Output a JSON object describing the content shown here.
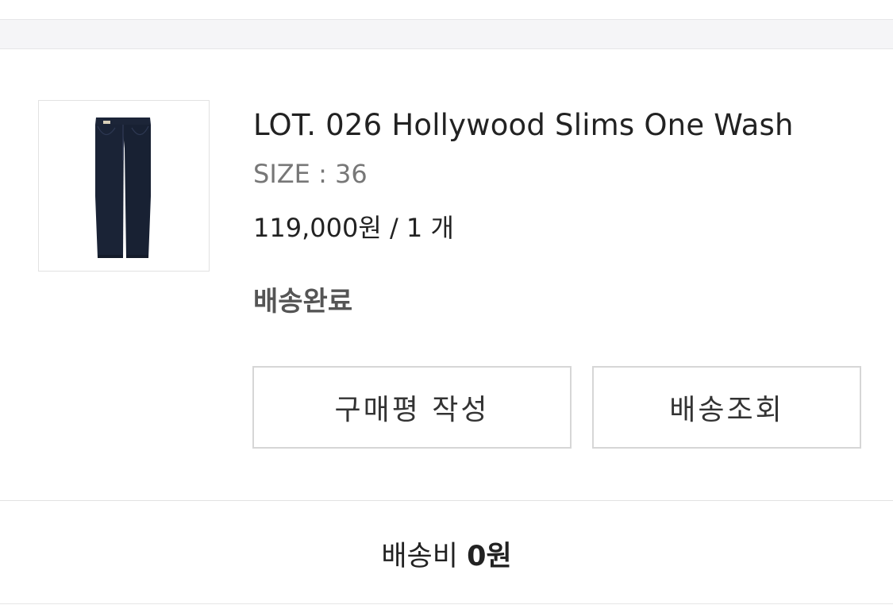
{
  "order_item": {
    "product_name": "LOT. 026 Hollywood Slims One Wash",
    "size_label": "SIZE",
    "size_separator": ":",
    "size_value": "36",
    "price": "119,000원",
    "quantity_separator": "/",
    "quantity": "1 개",
    "status": "배송완료",
    "thumbnail_icon": "jeans-image"
  },
  "actions": {
    "review_label": "구매평 작성",
    "track_label": "배송조회"
  },
  "shipping": {
    "label": "배송비",
    "value": "0원"
  },
  "colors": {
    "denim": "#1a2336",
    "background_band": "#f5f5f7"
  }
}
